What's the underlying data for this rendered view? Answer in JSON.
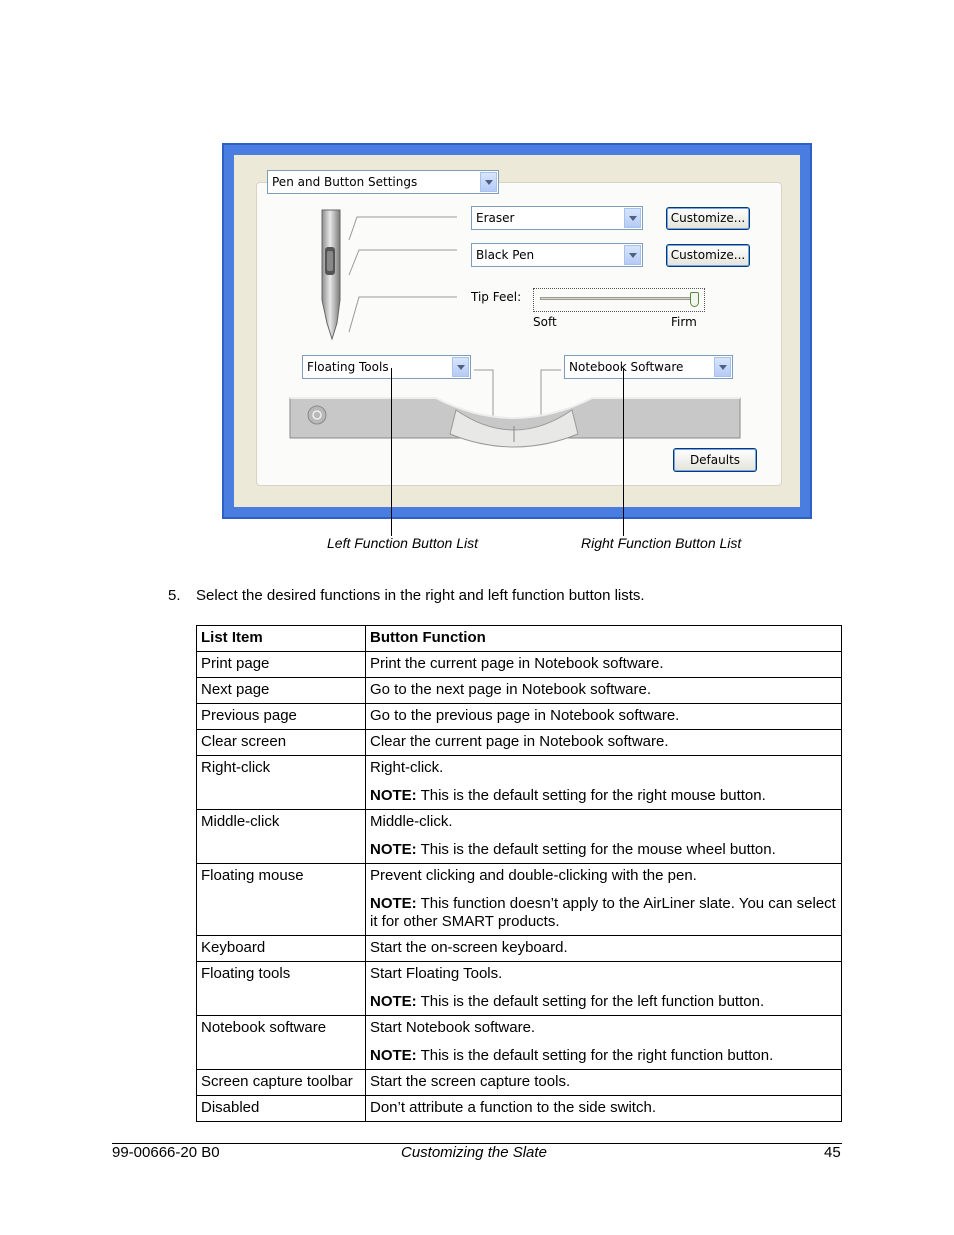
{
  "dialog": {
    "settings_combo": "Pen and Button Settings",
    "eraser_combo": "Eraser",
    "pen_combo": "Black Pen",
    "customize_label": "Customize...",
    "tip_feel_label": "Tip Feel:",
    "soft_label": "Soft",
    "firm_label": "Firm",
    "tip_feel_level": 0.97,
    "left_combo": "Floating Tools",
    "right_combo": "Notebook Software",
    "defaults_label": "Defaults",
    "accent": "#4a7de0"
  },
  "captions": {
    "left": "Left Function Button List",
    "right": "Right Function Button List"
  },
  "step": {
    "number": "5.",
    "text": "Select the desired functions in the right and left function button lists."
  },
  "table": {
    "headers": [
      "List Item",
      "Button Function"
    ],
    "note_label": "NOTE:",
    "rows": [
      {
        "item": "Print page",
        "function": "Print the current page in Notebook software.",
        "note": ""
      },
      {
        "item": "Next page",
        "function": "Go to the next page in Notebook software.",
        "note": ""
      },
      {
        "item": "Previous page",
        "function": "Go to the previous page in Notebook software.",
        "note": ""
      },
      {
        "item": "Clear screen",
        "function": "Clear the current page in Notebook software.",
        "note": ""
      },
      {
        "item": "Right-click",
        "function": "Right-click.",
        "note": "This is the default setting for the right mouse button."
      },
      {
        "item": "Middle-click",
        "function": "Middle-click.",
        "note": "This is the default setting for the mouse wheel button."
      },
      {
        "item": "Floating mouse",
        "function": "Prevent clicking and double-clicking with the pen.",
        "note": "This function doesn’t apply to the AirLiner slate. You can select it for other SMART products."
      },
      {
        "item": "Keyboard",
        "function": "Start the on-screen keyboard.",
        "note": ""
      },
      {
        "item": "Floating tools",
        "function": "Start Floating Tools.",
        "note": "This is the default setting for the left function button."
      },
      {
        "item": "Notebook software",
        "function": "Start Notebook software.",
        "note": "This is the default setting for the right function button."
      },
      {
        "item": "Screen capture toolbar",
        "function": "Start the screen capture tools.",
        "note": ""
      },
      {
        "item": "Disabled",
        "function": "Don’t attribute a function to the side switch.",
        "note": ""
      }
    ]
  },
  "footer": {
    "doc_number": "99-00666-20 B0",
    "section": "Customizing the Slate",
    "page": "45"
  }
}
